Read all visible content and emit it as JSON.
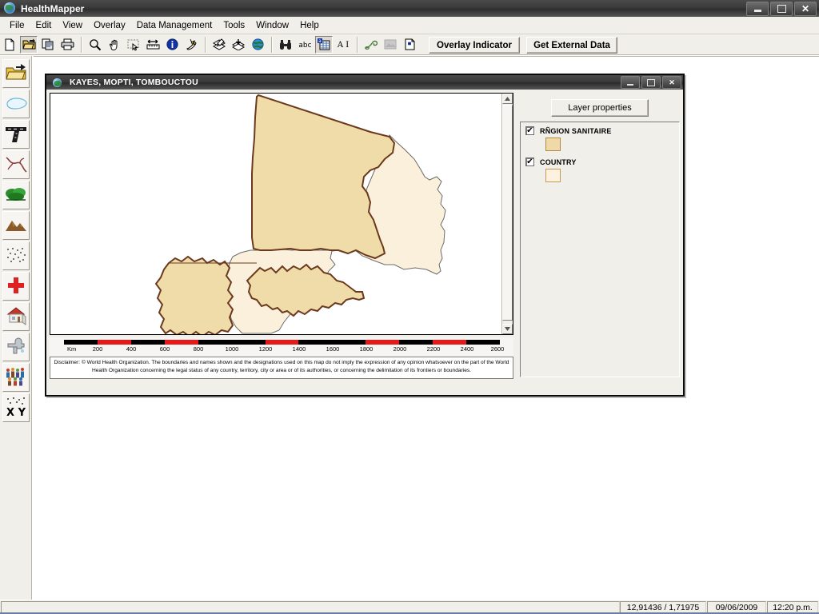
{
  "window": {
    "title": "HealthMapper",
    "icon": "globe-icon",
    "minimize": "minimize",
    "restore": "restore",
    "close": "close"
  },
  "menubar": {
    "items": [
      {
        "label": "File"
      },
      {
        "label": "Edit"
      },
      {
        "label": "View"
      },
      {
        "label": "Overlay"
      },
      {
        "label": "Data Management"
      },
      {
        "label": "Tools"
      },
      {
        "label": "Window"
      },
      {
        "label": "Help"
      }
    ]
  },
  "toolbar": {
    "buttons": [
      {
        "name": "new-document-icon",
        "pressed": false
      },
      {
        "name": "open-folder-icon",
        "pressed": true
      },
      {
        "name": "copy-icon",
        "pressed": false
      },
      {
        "name": "print-icon",
        "pressed": false
      },
      {
        "name": "zoom-icon",
        "pressed": false
      },
      {
        "name": "pan-hand-icon",
        "pressed": false
      },
      {
        "name": "select-rectangle-icon",
        "pressed": false
      },
      {
        "name": "measure-icon",
        "pressed": false
      },
      {
        "name": "info-icon",
        "pressed": false
      },
      {
        "name": "hotlink-icon",
        "pressed": false
      },
      {
        "name": "map-layers-edit-icon",
        "pressed": false
      },
      {
        "name": "add-layer-icon",
        "pressed": false
      },
      {
        "name": "globe-layer-icon",
        "pressed": false
      },
      {
        "name": "find-binoculars-icon",
        "pressed": false
      },
      {
        "name": "label-abc-icon",
        "pressed": false
      },
      {
        "name": "table-icon",
        "pressed": true
      },
      {
        "name": "annotate-text-icon",
        "pressed": false
      },
      {
        "name": "link-icon",
        "pressed": false
      },
      {
        "name": "image-icon",
        "pressed": false
      },
      {
        "name": "new-page-icon",
        "pressed": false
      }
    ],
    "overlay_indicator_label": "Overlay Indicator",
    "get_external_data_label": "Get External Data"
  },
  "palette": {
    "items": [
      {
        "name": "open-folder-icon",
        "label": "Open"
      },
      {
        "name": "water-body-icon",
        "label": "Water body"
      },
      {
        "name": "road-icon",
        "label": "Roads"
      },
      {
        "name": "river-icon",
        "label": "Rivers"
      },
      {
        "name": "vegetation-icon",
        "label": "Vegetation"
      },
      {
        "name": "mountains-icon",
        "label": "Relief"
      },
      {
        "name": "soil-dots-icon",
        "label": "Soil"
      },
      {
        "name": "health-facility-icon",
        "label": "Health facility"
      },
      {
        "name": "village-house-icon",
        "label": "Village"
      },
      {
        "name": "water-tap-icon",
        "label": "Water point"
      },
      {
        "name": "population-icon",
        "label": "Population"
      },
      {
        "name": "xy-coordinates-icon",
        "label": "X Y"
      }
    ]
  },
  "child_window": {
    "title": "KAYES, MOPTI, TOMBOUCTOU",
    "icon": "globe-icon",
    "minimize": "minimize",
    "restore": "restore",
    "close": "close"
  },
  "layer_panel": {
    "properties_button": "Layer properties",
    "layers": [
      {
        "name": "RÑGION SANITAIRE",
        "checked": true,
        "color": "#EFD9A9",
        "border": "#B08A3E"
      },
      {
        "name": "COUNTRY",
        "checked": true,
        "color": "#FCF2DF",
        "border": "#C79A52"
      }
    ]
  },
  "map": {
    "unit": "Km",
    "scale_ticks": [
      "200",
      "400",
      "600",
      "800",
      "1000",
      "1200",
      "1400",
      "1600",
      "1800",
      "2000",
      "2200",
      "2400",
      "2600"
    ],
    "scale_max": 2600,
    "region_fill": "#EFDCA9",
    "region_stroke": "#6B3A1E",
    "country_fill": "#FBF0DC",
    "country_stroke": "#555555",
    "background": "#FFFFFF",
    "disclaimer": "Disclaimer: © World Health Organization. The boundaries and names shown and the designations used on this map do not imply the expression of any opinion whatsoever on the part of the World Health Organization concerning the legal status of any country, territory, city or area or of its authorities, or concerning the delimitation of its frontiers or boundaries."
  },
  "statusbar": {
    "message": "",
    "coordinates": "12,91436 / 1,71975",
    "date": "09/06/2009",
    "time": "12:20 p.m."
  }
}
